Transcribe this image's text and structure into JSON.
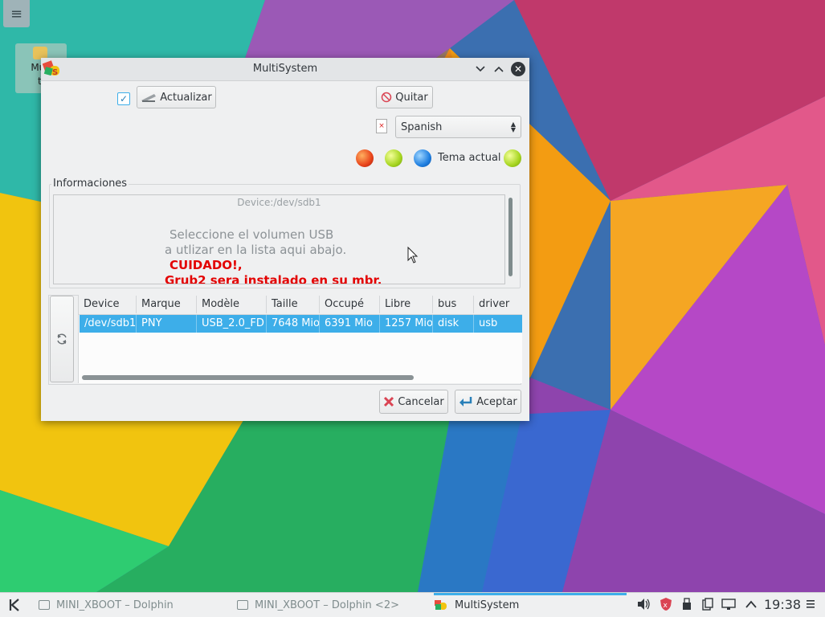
{
  "desktop": {
    "icon_label_1": "Multi",
    "icon_label_2": "te",
    "menu_glyph": "≡"
  },
  "window": {
    "title": "MultiSystem",
    "app_logo_letter": "S"
  },
  "toolbar": {
    "update_checked": true,
    "update_label": "Actualizar",
    "quit_label": "Quitar",
    "language_value": "Spanish",
    "theme_label": "Tema actual"
  },
  "info": {
    "group_label": "Informaciones",
    "device": "Device:/dev/sdb1",
    "line1": "Seleccione el volumen USB",
    "line2": "a utlizar en la lista aqui abajo.",
    "line3": "CUIDADO!,",
    "line4": "Grub2 sera instalado en su mbr."
  },
  "table": {
    "columns": [
      "Device",
      "Marque",
      "Modèle",
      "Taille",
      "Occupé",
      "Libre",
      "bus",
      "driver"
    ],
    "rows": [
      [
        "/dev/sdb1",
        "PNY",
        "USB_2.0_FD",
        "7648 Mio",
        "6391 Mio",
        "1257 Mio",
        "disk",
        "usb"
      ]
    ]
  },
  "actions": {
    "cancel_label": "Cancelar",
    "accept_label": "Aceptar"
  },
  "taskbar": {
    "tasks": [
      "MINI_XBOOT – Dolphin",
      "MINI_XBOOT – Dolphin <2>",
      "MultiSystem"
    ],
    "active_task": "MultiSystem",
    "clock": "19:38"
  },
  "colors": {
    "accent": "#3daee9",
    "warning_text": "#e30000",
    "window_bg": "#eff0f1"
  }
}
